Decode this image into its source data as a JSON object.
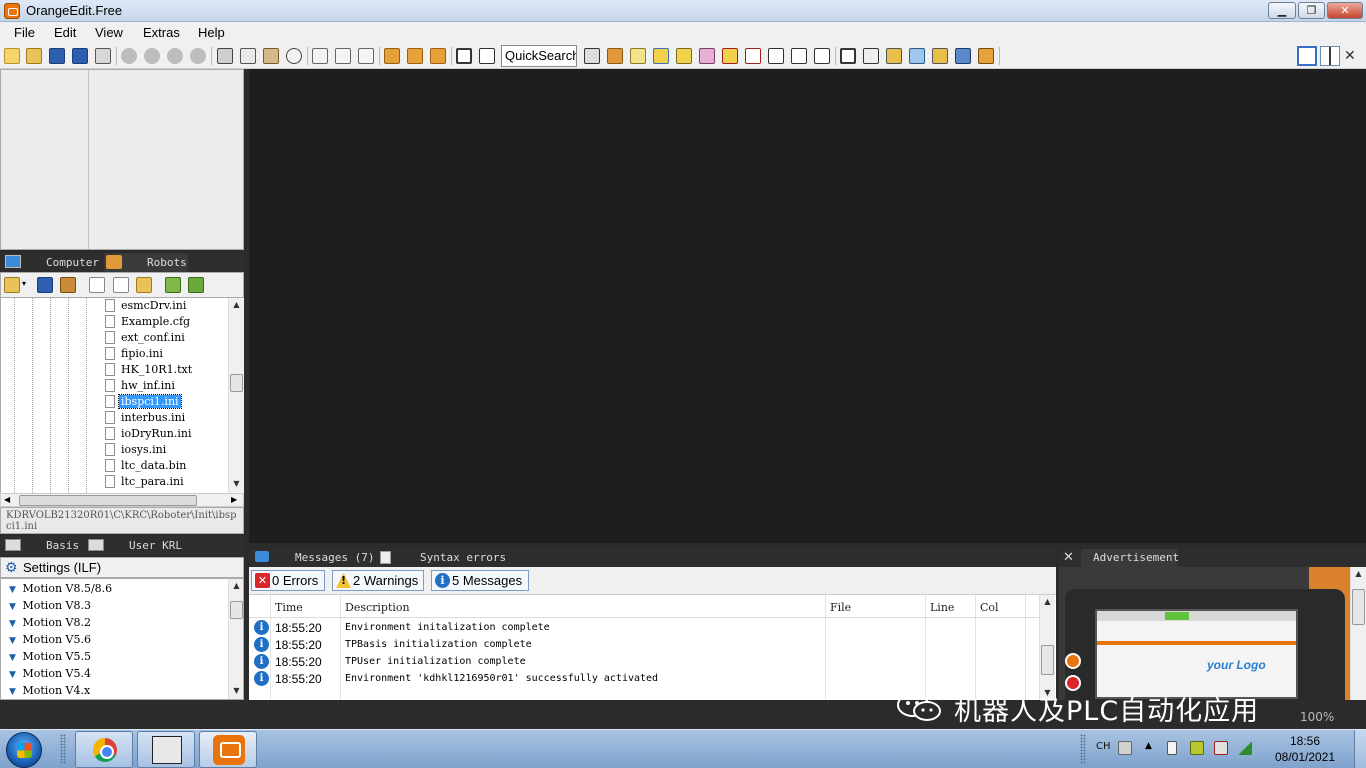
{
  "window": {
    "title": "OrangeEdit.Free",
    "min_glyph": "▁",
    "max_glyph": "❐",
    "close_glyph": "✕"
  },
  "menu": {
    "items": [
      "File",
      "Edit",
      "View",
      "Extras",
      "Help"
    ]
  },
  "toolbar": {
    "quicksearch_label": "QuickSearch"
  },
  "explorer": {
    "tabs": [
      {
        "label": "Computer",
        "icon": "monitor-icon"
      },
      {
        "label": "Robots",
        "icon": "robot-arm-icon"
      }
    ],
    "files": [
      "esmcDrv.ini",
      "Example.cfg",
      "ext_conf.ini",
      "fipio.ini",
      "HK_10R1.txt",
      "hw_inf.ini",
      "ibspci1.ini",
      "interbus.ini",
      "ioDryRun.ini",
      "iosys.ini",
      "ltc_data.bin",
      "ltc_para.ini"
    ],
    "selected_file": "ibspci1.ini",
    "path": "KDRVOLB21320R01\\C\\KRC\\Roboter\\Init\\ibspci1.ini"
  },
  "bottom_left": {
    "tabs": [
      {
        "label": "Basis"
      },
      {
        "label": "User  KRL"
      }
    ],
    "settings_title": "Settings (ILF)",
    "items": [
      "Motion V8.5/8.6",
      "Motion V8.3",
      "Motion V8.2",
      "Motion V5.6",
      "Motion V5.5",
      "Motion V5.4",
      "Motion V4.x"
    ]
  },
  "messages": {
    "tab_label": "Messages (7)",
    "syntax_tab_label": "Syntax errors",
    "filters": {
      "errors": "0 Errors",
      "warnings": "2 Warnings",
      "messages": "5 Messages"
    },
    "columns": [
      "Time",
      "Description",
      "File",
      "Line",
      "Col"
    ],
    "rows": [
      {
        "time": "18:55:20",
        "description": "Environment initalization complete"
      },
      {
        "time": "18:55:20",
        "description": "TPBasis initialization complete"
      },
      {
        "time": "18:55:20",
        "description": "TPUser initialization complete"
      },
      {
        "time": "18:55:20",
        "description": "Environment 'kdhkl1216950r01' successfully activated"
      }
    ]
  },
  "advertisement": {
    "tab_label": "Advertisement",
    "logo_text": "your Logo"
  },
  "overlay": {
    "watermark": "机器人及PLC自动化应用",
    "zoom": "100%"
  },
  "taskbar": {
    "lang": "CH",
    "time": "18:56",
    "date": "08/01/2021"
  },
  "colors": {
    "accent_orange": "#e9730c",
    "editor_bg": "#1e1e1e",
    "selection_blue": "#3399ff",
    "info_blue": "#1f6fc4"
  }
}
